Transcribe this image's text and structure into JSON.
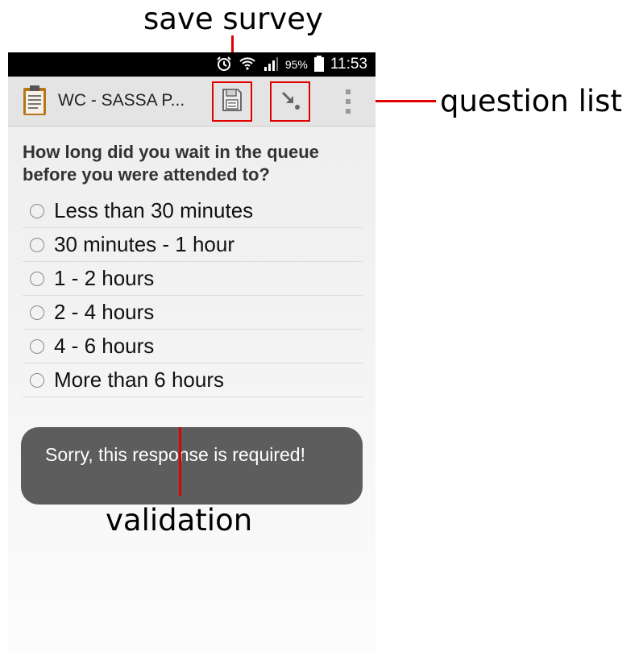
{
  "status_bar": {
    "battery": "95%",
    "time": "11:53",
    "icons": [
      "alarm-icon",
      "wifi-icon",
      "signal-icon",
      "battery-icon"
    ]
  },
  "action_bar": {
    "title": "WC - SASSA P...",
    "app_icon": "clipboard-icon",
    "save_icon": "floppy-disk-icon",
    "question_list_icon": "jump-arrow-icon",
    "overflow_icon": "vertical-dots-icon"
  },
  "question": {
    "text": "How long did you wait in the queue before you were attended to?",
    "options": [
      "Less than 30 minutes",
      "30 minutes - 1 hour",
      "1 - 2 hours",
      "2 - 4 hours",
      "4 - 6 hours",
      "More than 6 hours"
    ]
  },
  "toast": {
    "message": "Sorry, this response is required!"
  },
  "annotations": {
    "save": "save survey",
    "question_list": "question list",
    "validation": "validation"
  },
  "colors": {
    "annotation_red": "#e00000",
    "action_bar": "#e4e4e4",
    "toast": "#5d5d5d",
    "status_bar": "#000000"
  }
}
